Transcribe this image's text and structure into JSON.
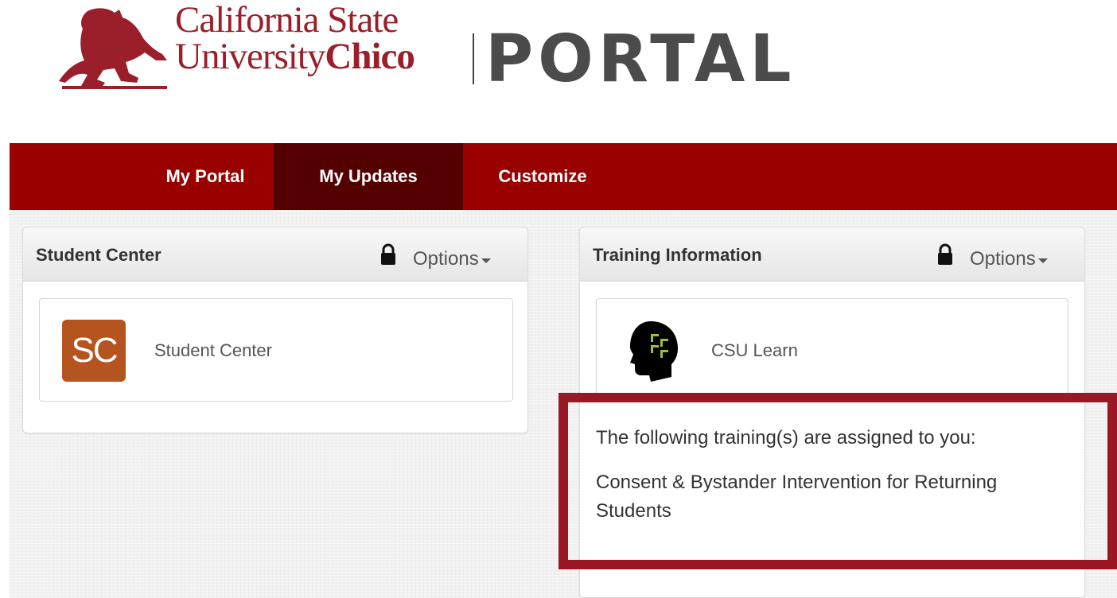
{
  "header": {
    "university_line1": "California State",
    "university_line2_a": "University",
    "university_line2_b": "Chico",
    "portal_word": "PORTAL"
  },
  "nav": {
    "tabs": [
      {
        "label": "My Portal",
        "active": false
      },
      {
        "label": "My Updates",
        "active": true
      },
      {
        "label": "Customize",
        "active": false
      }
    ]
  },
  "portlets": [
    {
      "title": "Student Center",
      "options_label": "Options",
      "app": {
        "label": "Student Center",
        "icon_text": "SC",
        "icon": "student-center-icon"
      }
    },
    {
      "title": "Training Information",
      "options_label": "Options",
      "app": {
        "label": "CSU Learn",
        "icon": "csu-learn-head-icon"
      },
      "training_intro": "The following training(s) are assigned to you:",
      "training_items": [
        "Consent & Bystander Intervention for Returning Students"
      ]
    }
  ],
  "colors": {
    "brand_red": "#990000",
    "active_tab": "#550000",
    "highlight": "#9a1824",
    "sc_icon": "#b5541f"
  }
}
